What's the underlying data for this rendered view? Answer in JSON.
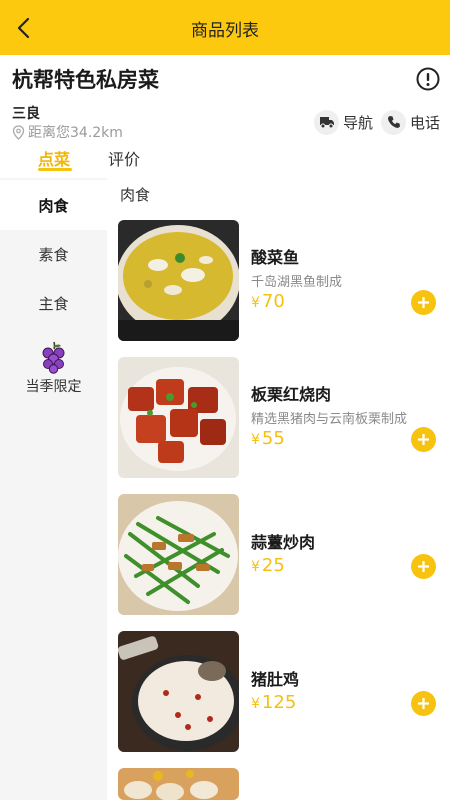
{
  "topbar": {
    "title": "商品列表"
  },
  "shop": {
    "name": "杭帮特色私房菜",
    "owner": "三良",
    "distance": "距离您34.2km",
    "actions": [
      {
        "label": "导航",
        "icon": "truck-icon"
      },
      {
        "label": "电话",
        "icon": "phone-icon"
      }
    ]
  },
  "tabs": [
    {
      "label": "点菜",
      "active": true
    },
    {
      "label": "评价",
      "active": false
    }
  ],
  "sidebar": {
    "items": [
      {
        "label": "肉食",
        "active": true
      },
      {
        "label": "素食",
        "active": false
      },
      {
        "label": "主食",
        "active": false
      }
    ],
    "special": {
      "label": "当季限定",
      "icon": "grape-icon"
    }
  },
  "section": {
    "title": "肉食"
  },
  "items": [
    {
      "name": "酸菜鱼",
      "desc": "千岛湖黑鱼制成",
      "currency": "¥",
      "price": "70"
    },
    {
      "name": "板栗红烧肉",
      "desc": "精选黑猪肉与云南板栗制成",
      "currency": "¥",
      "price": "55"
    },
    {
      "name": "蒜薹炒肉",
      "desc": "",
      "currency": "¥",
      "price": "25"
    },
    {
      "name": "猪肚鸡",
      "desc": "",
      "currency": "¥",
      "price": "125"
    }
  ],
  "colors": {
    "brand": "#fdc90f",
    "accent": "#f6c012",
    "sidebar_bg": "#f5f5f5"
  }
}
